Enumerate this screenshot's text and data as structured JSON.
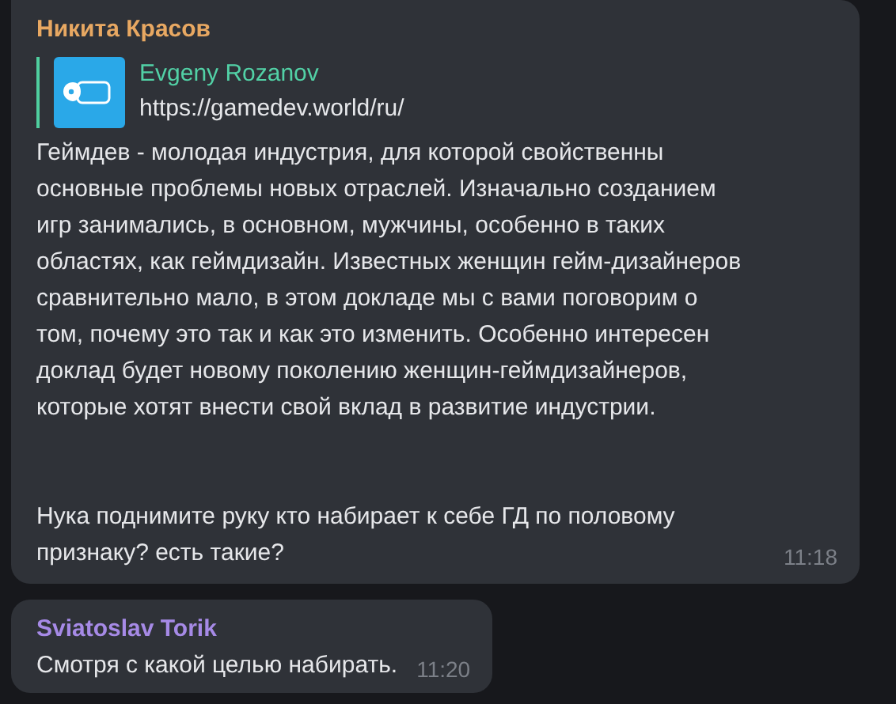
{
  "messages": [
    {
      "sender": "Никита Красов",
      "color": "#e8a862",
      "preview": {
        "title": "Evgeny Rozanov",
        "url": "https://gamedev.world/ru/"
      },
      "text": "Геймдев - молодая индустрия, для которой свойственны\nосновные проблемы новых отраслей. Изначально созданием\nигр занимались, в основном, мужчины, особенно в таких\nобластях, как геймдизайн. Известных женщин гейм-дизайнеров\nсравнительно мало, в этом докладе мы с вами поговорим о\nтом, почему это так и как это изменить. Особенно интересен\nдоклад будет новому поколению женщин-геймдизайнеров,\nкоторые хотят внести свой вклад в развитие индустрии.\n\n\nНука поднимите руку кто набирает к себе ГД по половому\nпризнаку? есть такие?",
      "time": "11:18"
    },
    {
      "sender": "Sviatoslav Torik",
      "color": "#a68ae6",
      "text": "Смотря с какой целью набирать.",
      "time": "11:20"
    }
  ]
}
